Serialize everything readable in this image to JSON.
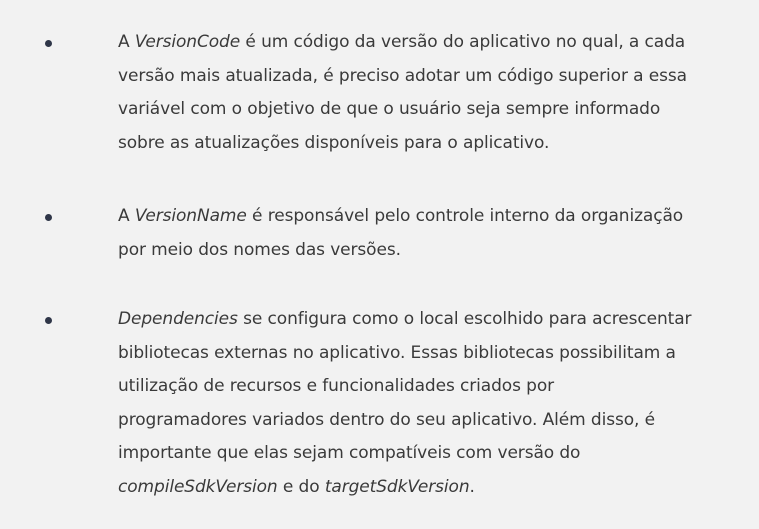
{
  "items": [
    {
      "lines": [
        [
          {
            "t": "A "
          },
          {
            "t": "VersionCode",
            "i": true
          },
          {
            "t": " é um código da versão do aplicativo no qual, a cada"
          }
        ],
        [
          {
            "t": "versão mais atualizada, é preciso adotar um código superior a essa"
          }
        ],
        [
          {
            "t": "variável com o objetivo de que o usuário seja sempre informado"
          }
        ],
        [
          {
            "t": "sobre as atualizações disponíveis para o aplicativo."
          }
        ]
      ]
    },
    {
      "lines": [
        [
          {
            "t": "A "
          },
          {
            "t": "VersionName",
            "i": true
          },
          {
            "t": " é responsável pelo controle interno da organização"
          }
        ],
        [
          {
            "t": "por meio dos nomes das versões."
          }
        ]
      ]
    },
    {
      "lines": [
        [
          {
            "t": "Dependencies",
            "i": true
          },
          {
            "t": " se configura como o local escolhido para acrescentar"
          }
        ],
        [
          {
            "t": "bibliotecas externas no aplicativo. Essas bibliotecas possibilitam a"
          }
        ],
        [
          {
            "t": "utilização de recursos e funcionalidades criados por"
          }
        ],
        [
          {
            "t": "programadores variados dentro do seu aplicativo.  Além disso, é"
          }
        ],
        [
          {
            "t": "importante que elas sejam compatíveis com versão do"
          }
        ],
        [
          {
            "t": "compileSdkVersion",
            "i": true
          },
          {
            "t": " e do "
          },
          {
            "t": "targetSdkVersion",
            "i": true
          },
          {
            "t": "."
          }
        ]
      ]
    }
  ]
}
